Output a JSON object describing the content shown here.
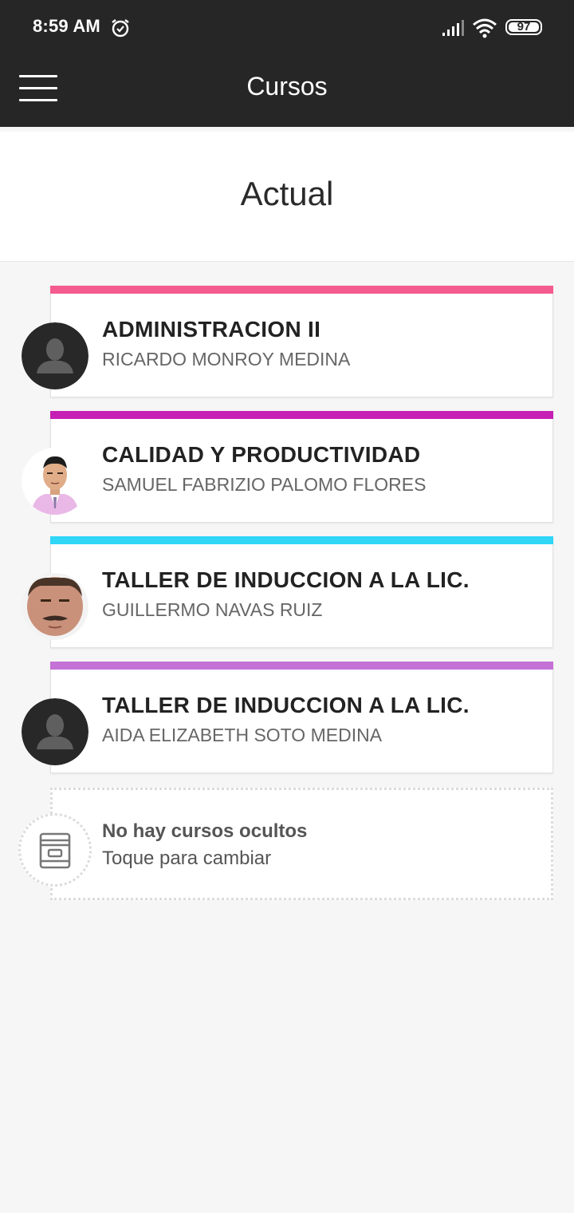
{
  "status_bar": {
    "time": "8:59 AM",
    "battery": "97"
  },
  "appbar": {
    "title": "Cursos",
    "menu_icon": "hamburger-menu-icon"
  },
  "section": {
    "title": "Actual"
  },
  "courses": [
    {
      "title": "ADMINISTRACION II",
      "teacher": "RICARDO MONROY MEDINA",
      "color": "#f45b8e",
      "avatar": "default-user-icon"
    },
    {
      "title": "CALIDAD Y PRODUCTIVIDAD",
      "teacher": "SAMUEL FABRIZIO PALOMO FLORES",
      "color": "#c61fb4",
      "avatar": "teacher-photo"
    },
    {
      "title": "TALLER DE INDUCCION A LA LIC.",
      "teacher": "GUILLERMO NAVAS RUIZ",
      "color": "#2fd6f6",
      "avatar": "teacher-photo"
    },
    {
      "title": "TALLER DE INDUCCION A LA LIC.",
      "teacher": "AIDA ELIZABETH SOTO MEDINA",
      "color": "#c472d5",
      "avatar": "default-user-icon"
    }
  ],
  "hidden": {
    "title": "No hay cursos ocultos",
    "subtitle": "Toque para cambiar",
    "icon": "archive-icon"
  }
}
